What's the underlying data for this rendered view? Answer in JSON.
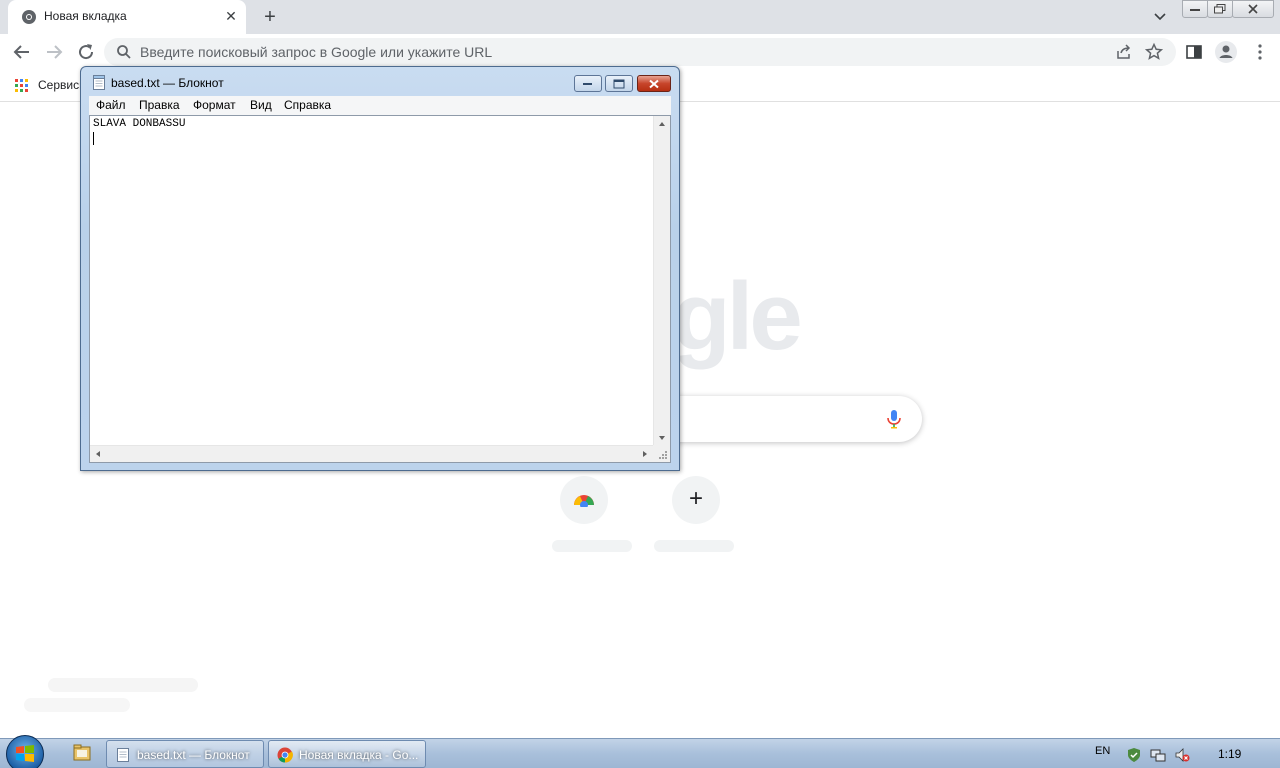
{
  "browser": {
    "tab": {
      "title": "Новая вкладка",
      "close_glyph": "✕"
    },
    "new_tab_glyph": "+",
    "omnibox": {
      "placeholder": "Введите поисковый запрос в Google или укажите URL"
    },
    "bookmarks": {
      "apps_label": "Сервисы"
    },
    "ntp": {
      "logo_partial": "gle",
      "shortcut_add_glyph": "+"
    }
  },
  "notepad": {
    "title": "based.txt — Блокнот",
    "menu": [
      "Файл",
      "Правка",
      "Формат",
      "Вид",
      "Справка"
    ],
    "content": "SLAVA DONBASSU"
  },
  "taskbar": {
    "tasks": [
      {
        "label": "based.txt — Блокнот",
        "icon": "notepad-icon"
      },
      {
        "label": "Новая вкладка - Go...",
        "icon": "chrome-icon"
      }
    ],
    "language": "EN",
    "clock": "1:19"
  },
  "colors": {
    "tabstrip": "#dee1e6",
    "omnibox_bg": "#f1f3f4",
    "notepad_frame": "#b9d1ea",
    "taskbar": "#a9c0db",
    "close_button": "#c7452b"
  }
}
